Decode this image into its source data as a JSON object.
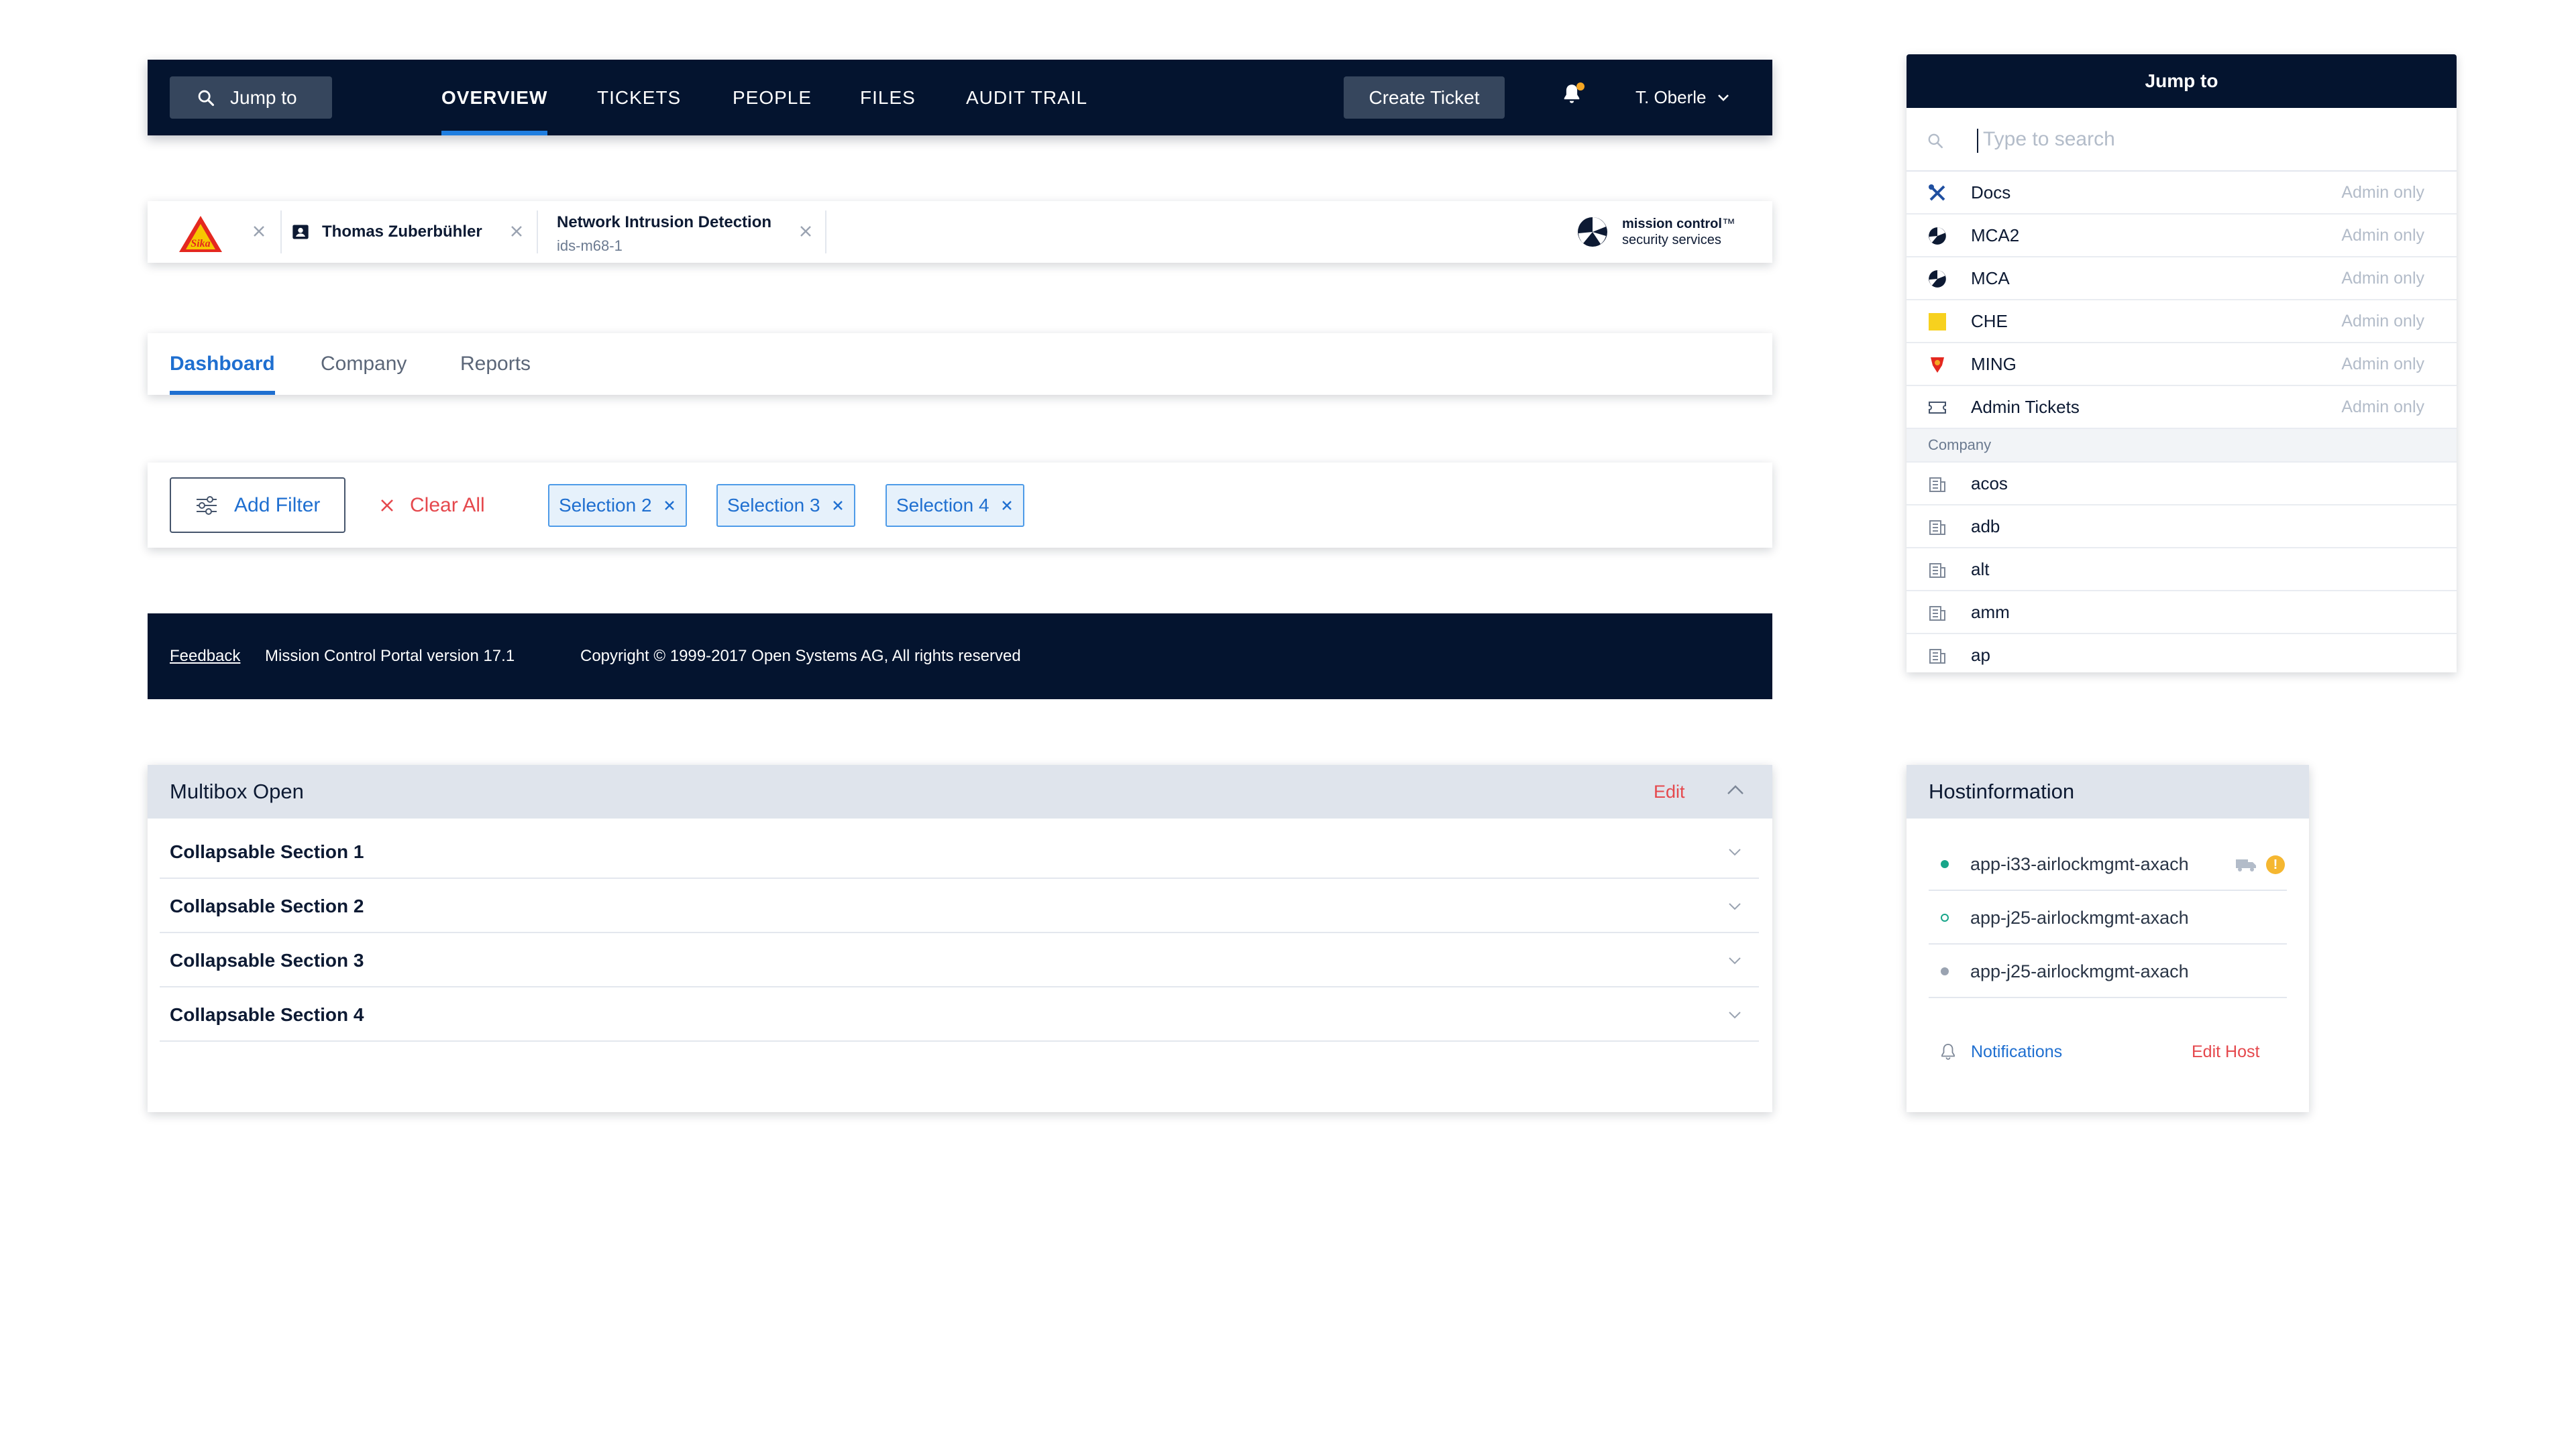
{
  "topnav": {
    "jump_label": "Jump to",
    "items": [
      "OVERVIEW",
      "TICKETS",
      "PEOPLE",
      "FILES",
      "AUDIT TRAIL"
    ],
    "active_item": "OVERVIEW",
    "create_button": "Create Ticket",
    "user_name": "T. Oberle",
    "notification_dot_color": "#f5a623"
  },
  "contextbar": {
    "company_logo_text": "Sika",
    "person_name": "Thomas Zuberbühler",
    "service_title": "Network Intrusion Detection",
    "service_id": "ids-m68-1",
    "brand_line1": "mission control",
    "brand_tm": "™",
    "brand_line2": "security services"
  },
  "tabs": {
    "items": [
      "Dashboard",
      "Company",
      "Reports"
    ],
    "active": "Dashboard"
  },
  "filterbar": {
    "add_filter": "Add Filter",
    "clear_all": "Clear All",
    "chips": [
      "Selection 2",
      "Selection 3",
      "Selection 4"
    ]
  },
  "footer": {
    "feedback": "Feedback",
    "version": "Mission Control Portal version 17.1",
    "copyright": "Copyright © 1999-2017 Open Systems AG, All rights reserved"
  },
  "multibox": {
    "title": "Multibox Open",
    "edit": "Edit",
    "sections": [
      "Collapsable Section 1",
      "Collapsable Section 2",
      "Collapsable Section 3",
      "Collapsable Section 4"
    ]
  },
  "jumppanel": {
    "title": "Jump to",
    "search_placeholder": "Type to search",
    "admin_items": [
      {
        "name": "Docs",
        "badge": "Admin only",
        "icon": "tools-icon"
      },
      {
        "name": "MCA2",
        "badge": "Admin only",
        "icon": "mission-control-icon"
      },
      {
        "name": "MCA",
        "badge": "Admin only",
        "icon": "mission-control-icon"
      },
      {
        "name": "CHE",
        "badge": "Admin only",
        "icon": "yellow-square-icon"
      },
      {
        "name": "MING",
        "badge": "Admin only",
        "icon": "shield-logo-icon"
      },
      {
        "name": "Admin Tickets",
        "badge": "Admin only",
        "icon": "ticket-icon"
      }
    ],
    "company_header": "Company",
    "companies": [
      "acos",
      "adb",
      "alt",
      "amm",
      "ap"
    ]
  },
  "hostinfo": {
    "title": "Hostinformation",
    "hosts": [
      {
        "name": "app-i33-airlockmgmt-axach",
        "status": "online",
        "status_color": "#17a589"
      },
      {
        "name": "app-j25-airlockmgmt-axach",
        "status": "partial",
        "status_color": "#17a589"
      },
      {
        "name": "app-j25-airlockmgmt-axach",
        "status": "offline",
        "status_color": "#9aa3b1"
      }
    ],
    "warning_glyph": "!",
    "notifications": "Notifications",
    "edit_host": "Edit Host"
  }
}
